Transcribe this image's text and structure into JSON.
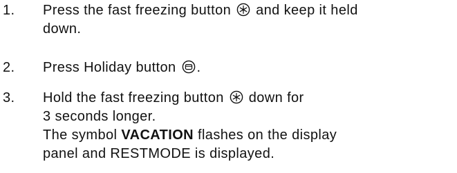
{
  "steps": [
    {
      "number": "1.",
      "line1_before_icon": "Press the fast freezing button",
      "line1_after_icon": "and keep it held",
      "line2": "down.",
      "icon": "fast-freeze-icon"
    },
    {
      "number": "2.",
      "line1_before_icon": "Press Holiday button",
      "line1_after_icon": ".",
      "icon": "holiday-icon"
    },
    {
      "number": "3.",
      "line1_before_icon": "Hold the fast freezing button",
      "line1_after_icon": "down for",
      "line2": "3 seconds longer.",
      "line3_before_bold": "The symbol",
      "line3_bold": "VACATION",
      "line3_after_bold": "flashes on the display",
      "line4": "panel and RESTMODE is displayed.",
      "icon": "fast-freeze-icon"
    }
  ],
  "colors": {
    "text": "#111111",
    "background": "#ffffff"
  }
}
